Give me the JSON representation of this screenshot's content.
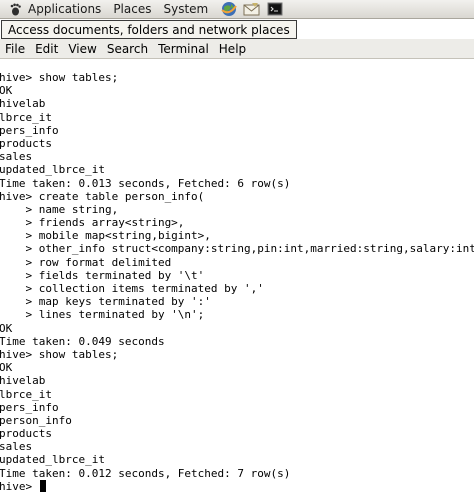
{
  "top_panel": {
    "menus": [
      "Applications",
      "Places",
      "System"
    ],
    "launchers": [
      "web-browser-icon",
      "mail-icon",
      "terminal-launcher-icon"
    ]
  },
  "tooltip": {
    "text": "Access documents, folders and network places"
  },
  "terminal": {
    "menu": [
      "File",
      "Edit",
      "View",
      "Search",
      "Terminal",
      "Help"
    ],
    "lines": [
      "hive> show tables;",
      "OK",
      "hivelab",
      "lbrce_it",
      "pers_info",
      "products",
      "sales",
      "updated_lbrce_it",
      "Time taken: 0.013 seconds, Fetched: 6 row(s)",
      "hive> create table person_info(",
      "    > name string,",
      "    > friends array<string>,",
      "    > mobile map<string,bigint>,",
      "    > other_info struct<company:string,pin:int,married:string,salary:int>)",
      "    > row format delimited",
      "    > fields terminated by '\\t'",
      "    > collection items terminated by ','",
      "    > map keys terminated by ':'",
      "    > lines terminated by '\\n';",
      "OK",
      "Time taken: 0.049 seconds",
      "hive> show tables;",
      "OK",
      "hivelab",
      "lbrce_it",
      "pers_info",
      "person_info",
      "products",
      "sales",
      "updated_lbrce_it",
      "Time taken: 0.012 seconds, Fetched: 7 row(s)"
    ],
    "prompt": "hive> "
  },
  "colors": {
    "panel_bg": "#e6e4df",
    "terminal_bg": "#ffffff",
    "terminal_text": "#000000",
    "tooltip_bg": "#f5f4ef"
  }
}
